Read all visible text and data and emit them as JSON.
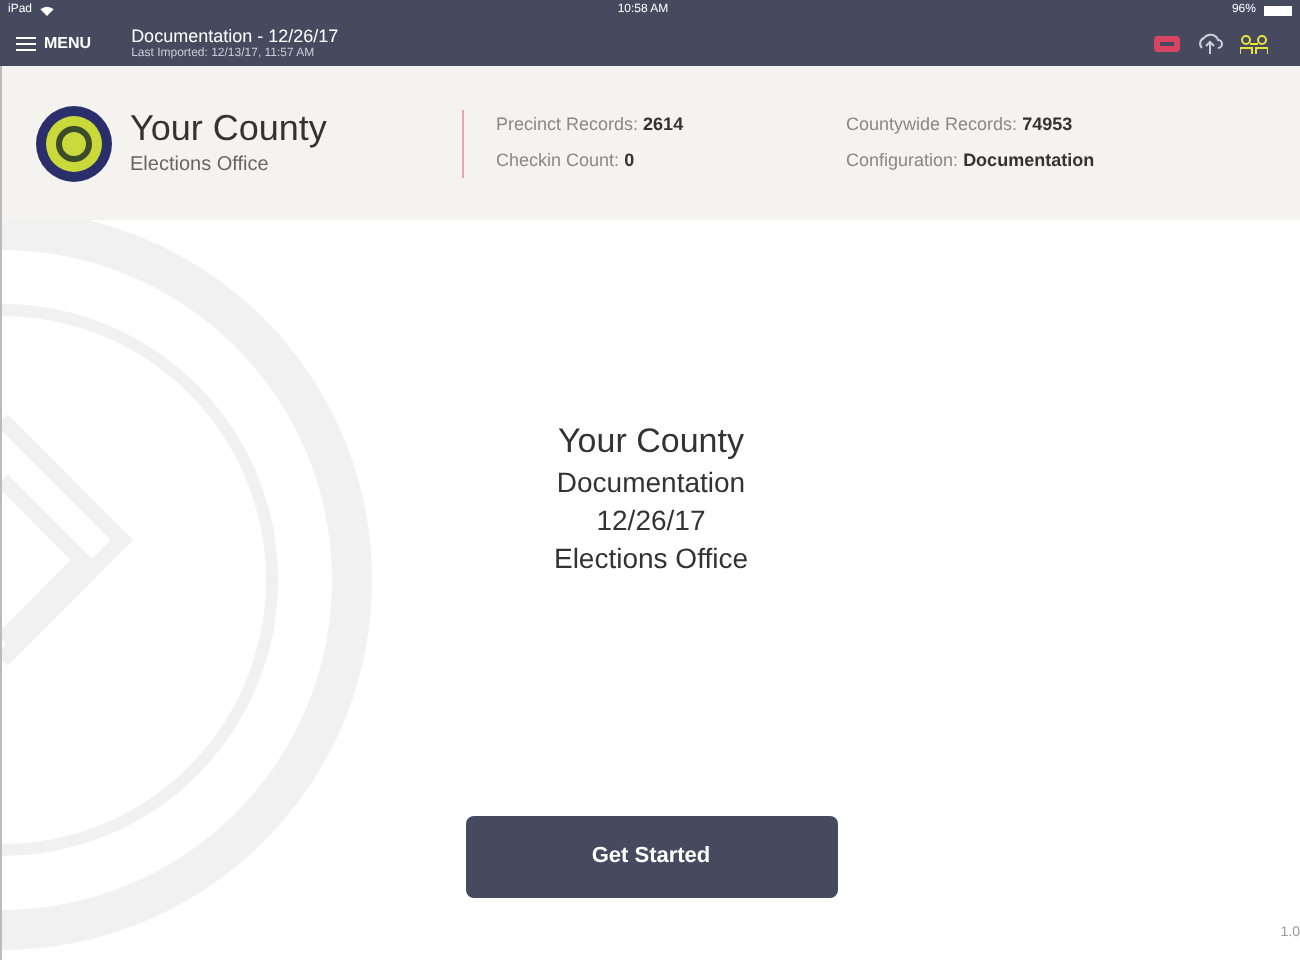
{
  "status_bar": {
    "device": "iPad",
    "time": "10:58 AM",
    "battery": "96%"
  },
  "nav_bar": {
    "menu_label": "MENU",
    "title": "Documentation - 12/26/17",
    "subtitle": "Last Imported: 12/13/17, 11:57 AM"
  },
  "header": {
    "county": "Your County",
    "office": "Elections Office",
    "stats": [
      {
        "label": "Precinct Records:",
        "value": "2614"
      },
      {
        "label": "Checkin Count:",
        "value": "0"
      },
      {
        "label": "Countywide Records:",
        "value": "74953"
      },
      {
        "label": "Configuration:",
        "value": "Documentation"
      }
    ]
  },
  "main": {
    "lines": [
      "Your County",
      "Documentation",
      "12/26/17",
      "Elections Office"
    ],
    "button": "Get Started",
    "version": "1.0"
  }
}
